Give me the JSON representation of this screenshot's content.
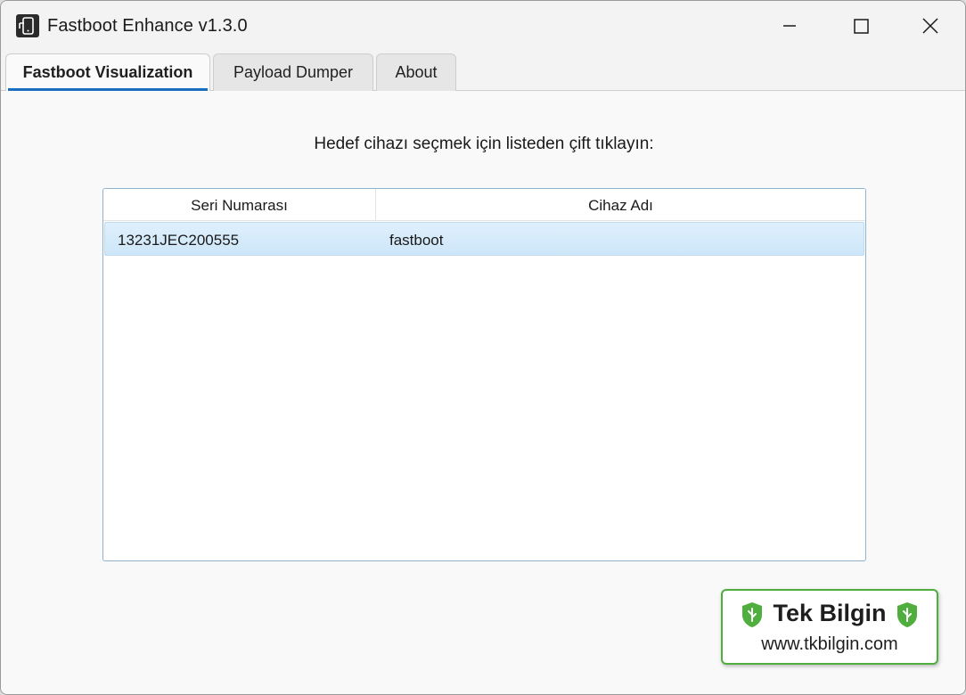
{
  "window": {
    "title": "Fastboot Enhance v1.3.0",
    "icons": {
      "app": "phone-app-icon",
      "minimize": "minimize-icon",
      "maximize": "maximize-icon",
      "close": "close-icon"
    }
  },
  "tabs": [
    {
      "label": "Fastboot Visualization",
      "active": true
    },
    {
      "label": "Payload Dumper",
      "active": false
    },
    {
      "label": "About",
      "active": false
    }
  ],
  "main": {
    "instruction": "Hedef cihazı seçmek için listeden çift tıklayın:",
    "table": {
      "columns": [
        "Seri Numarası",
        "Cihaz Adı"
      ],
      "rows": [
        {
          "serial": "13231JEC200555",
          "name": "fastboot",
          "selected": true
        }
      ]
    }
  },
  "watermark": {
    "name": "Tek Bilgin",
    "url": "www.tkbilgin.com",
    "icon": "green-shield-logo-icon",
    "color": "#4fae3d"
  },
  "colors": {
    "accent": "#1a6dbf",
    "selected_row": "#d6ebfa",
    "table_border": "#8fb3cf"
  }
}
